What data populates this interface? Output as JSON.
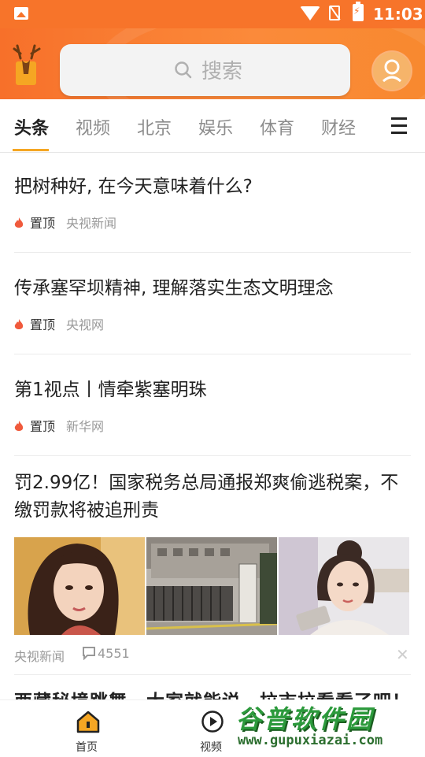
{
  "status_bar": {
    "time": "11:03"
  },
  "header": {
    "search_label": "搜索"
  },
  "tabs": [
    "头条",
    "视频",
    "北京",
    "娱乐",
    "体育",
    "财经"
  ],
  "feed": [
    {
      "title": "把树种好, 在今天意味着什么?",
      "pin": "置顶",
      "source": "央视新闻"
    },
    {
      "title": "传承塞罕坝精神, 理解落实生态文明理念",
      "pin": "置顶",
      "source": "央视网"
    },
    {
      "title": "第1视点丨情牵紫塞明珠",
      "pin": "置顶",
      "source": "新华网"
    },
    {
      "title_line1": "罚2.99亿！国家税务总局通报郑爽偷逃税案，不",
      "title_line2": "缴罚款将被追刑责",
      "source": "央视新闻",
      "comments": "4551"
    }
  ],
  "partial_next_title": "西藏秘境跳舞，大家就能说，拉市拉看看了吧！",
  "bottom_nav": {
    "home": "首页",
    "video": "视频"
  },
  "watermark": {
    "brand": "谷普软件园",
    "url": "www.gupuxiazai.com"
  },
  "colors": {
    "accent": "#f7742a",
    "tab_underline": "#f5a623",
    "flame": "#f05a3c"
  }
}
